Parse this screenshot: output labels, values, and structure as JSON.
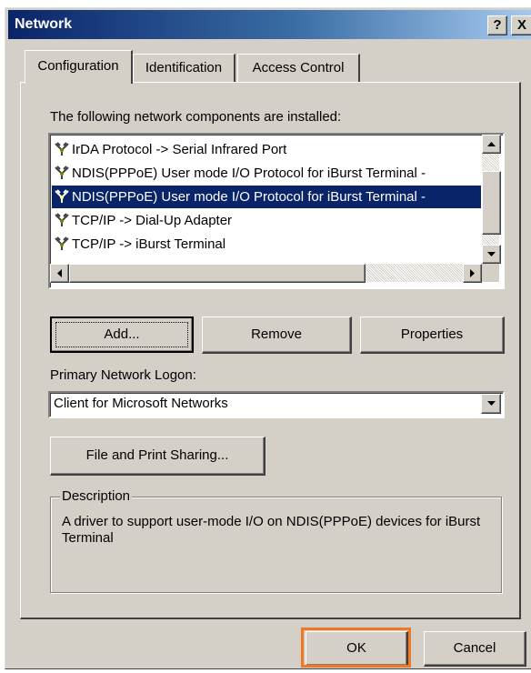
{
  "window": {
    "title": "Network",
    "help_button": "?",
    "close_button": "X"
  },
  "tabs": [
    {
      "label": "Configuration",
      "active": true
    },
    {
      "label": "Identification",
      "active": false
    },
    {
      "label": "Access Control",
      "active": false
    }
  ],
  "components": {
    "label": "The following network components are installed:",
    "items": [
      {
        "label": "IrDA Protocol -> Serial Infrared Port",
        "icon": "protocol-icon",
        "selected": false
      },
      {
        "label": "NDIS(PPPoE) User mode I/O Protocol for iBurst Terminal -",
        "icon": "protocol-icon",
        "selected": false
      },
      {
        "label": "NDIS(PPPoE) User mode I/O Protocol for iBurst Terminal -",
        "icon": "protocol-icon",
        "selected": true
      },
      {
        "label": "TCP/IP -> Dial-Up Adapter",
        "icon": "protocol-icon",
        "selected": false
      },
      {
        "label": "TCP/IP -> iBurst Terminal",
        "icon": "protocol-icon",
        "selected": false
      }
    ]
  },
  "buttons": {
    "add": "Add...",
    "remove": "Remove",
    "properties": "Properties",
    "file_print_sharing": "File and Print Sharing...",
    "ok": "OK",
    "cancel": "Cancel"
  },
  "logon": {
    "label": "Primary Network Logon:",
    "value": "Client for Microsoft Networks"
  },
  "description": {
    "label": "Description",
    "text": "A driver to support user-mode I/O on NDIS(PPPoE) devices for iBurst Terminal"
  },
  "colors": {
    "face": "#d4d0c8",
    "title_start": "#0a246a",
    "title_end": "#a6caf0",
    "selection": "#0a246a",
    "highlight_box": "#f07820"
  }
}
